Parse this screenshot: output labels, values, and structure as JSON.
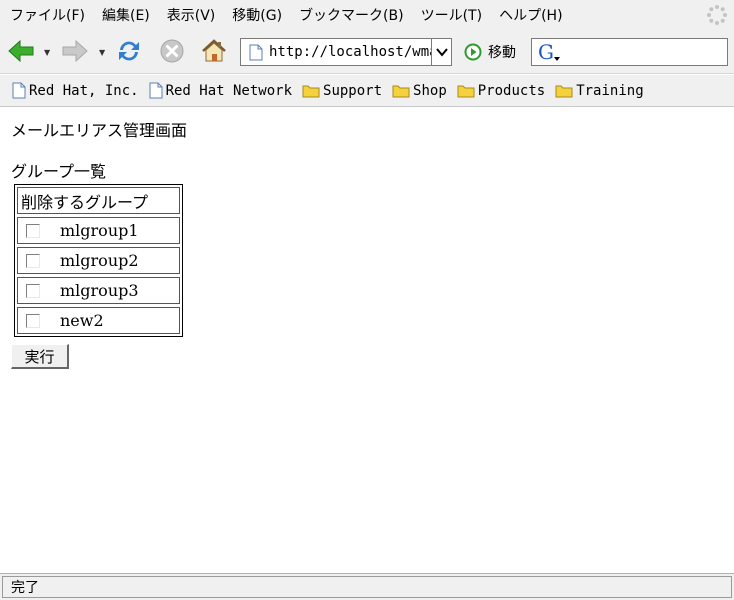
{
  "menubar": {
    "items": [
      {
        "label": "ファイル(F)"
      },
      {
        "label": "編集(E)"
      },
      {
        "label": "表示(V)"
      },
      {
        "label": "移動(G)"
      },
      {
        "label": "ブックマーク(B)"
      },
      {
        "label": "ツール(T)"
      },
      {
        "label": "ヘルプ(H)"
      }
    ]
  },
  "toolbar": {
    "url": "http://localhost/wmail/",
    "go_label": "移動"
  },
  "bookmarks": {
    "items": [
      {
        "label": "Red Hat, Inc.",
        "icon": "page-icon"
      },
      {
        "label": "Red Hat Network",
        "icon": "page-icon"
      },
      {
        "label": "Support",
        "icon": "folder-icon"
      },
      {
        "label": "Shop",
        "icon": "folder-icon"
      },
      {
        "label": "Products",
        "icon": "folder-icon"
      },
      {
        "label": "Training",
        "icon": "folder-icon"
      }
    ]
  },
  "page": {
    "title": "メールエリアス管理画面",
    "section_title": "グループ一覧",
    "table_header": "削除するグループ",
    "groups": [
      {
        "name": "mlgroup1",
        "checked": false
      },
      {
        "name": "mlgroup2",
        "checked": false
      },
      {
        "name": "mlgroup3",
        "checked": false
      },
      {
        "name": "new2",
        "checked": false
      }
    ],
    "submit_label": "実行"
  },
  "status": {
    "text": "完了"
  },
  "colors": {
    "chrome_bg": "#f0f0f0",
    "back_arrow": "#3cae2e",
    "reload": "#2f7fd1",
    "folder": "#f5d23c"
  }
}
